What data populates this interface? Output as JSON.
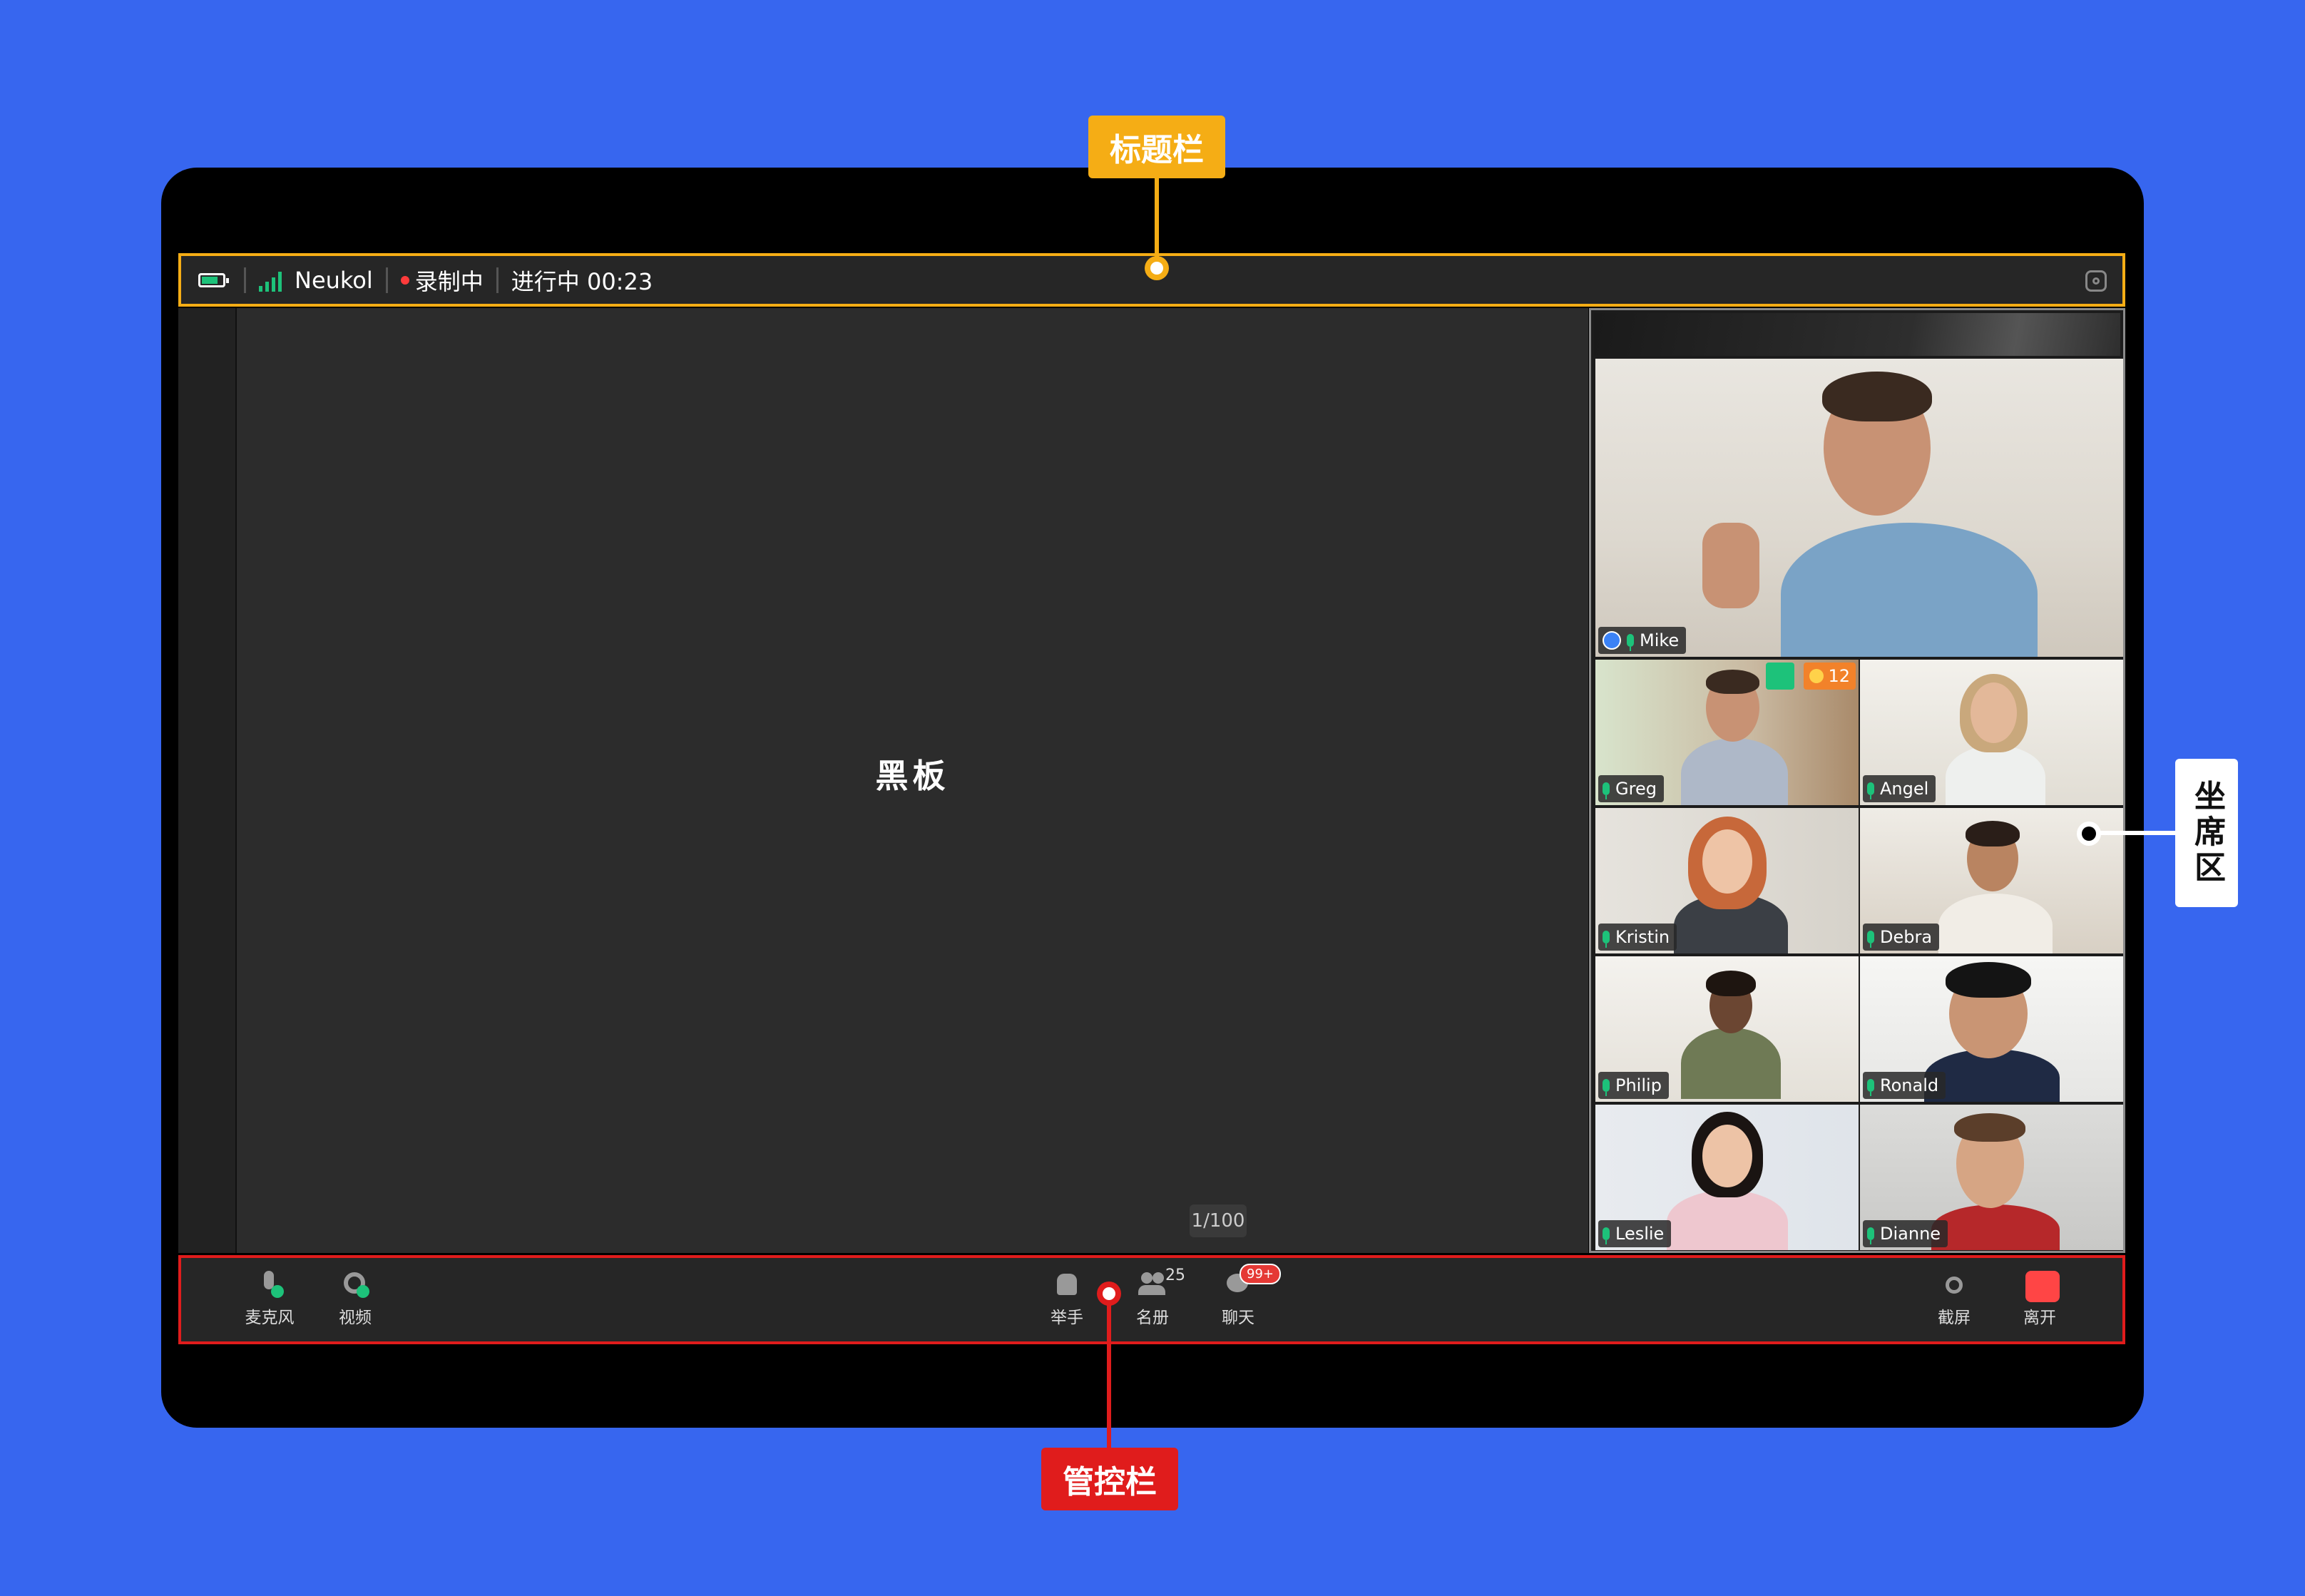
{
  "annotations": {
    "title_bar": "标题栏",
    "seat_area": "坐席区",
    "control_bar": "管控栏"
  },
  "titlebar": {
    "battery_icon": "battery-icon",
    "signal_icon": "signal-icon",
    "username": "Neukol",
    "recording": "录制中",
    "status": "进行中 00:23",
    "settings_icon": "settings-icon"
  },
  "board": {
    "label": "黑板",
    "page": "1/100"
  },
  "seats": {
    "main": {
      "name": "Mike"
    },
    "tiles": [
      {
        "name": "Greg",
        "badge_count": "12"
      },
      {
        "name": "Angel"
      },
      {
        "name": "Kristin"
      },
      {
        "name": "Debra"
      },
      {
        "name": "Philip"
      },
      {
        "name": "Ronald"
      },
      {
        "name": "Leslie"
      },
      {
        "name": "Dianne"
      }
    ]
  },
  "controls": {
    "mic": "麦克风",
    "video": "视频",
    "raise_hand": "举手",
    "roster": "名册",
    "roster_count": "25",
    "chat": "聊天",
    "chat_badge": "99+",
    "screenshot": "截屏",
    "leave": "离开"
  },
  "colors": {
    "background": "#3766ef",
    "title_highlight": "#f5ad15",
    "control_highlight": "#e01c1c",
    "accent_green": "#1dc27a"
  }
}
